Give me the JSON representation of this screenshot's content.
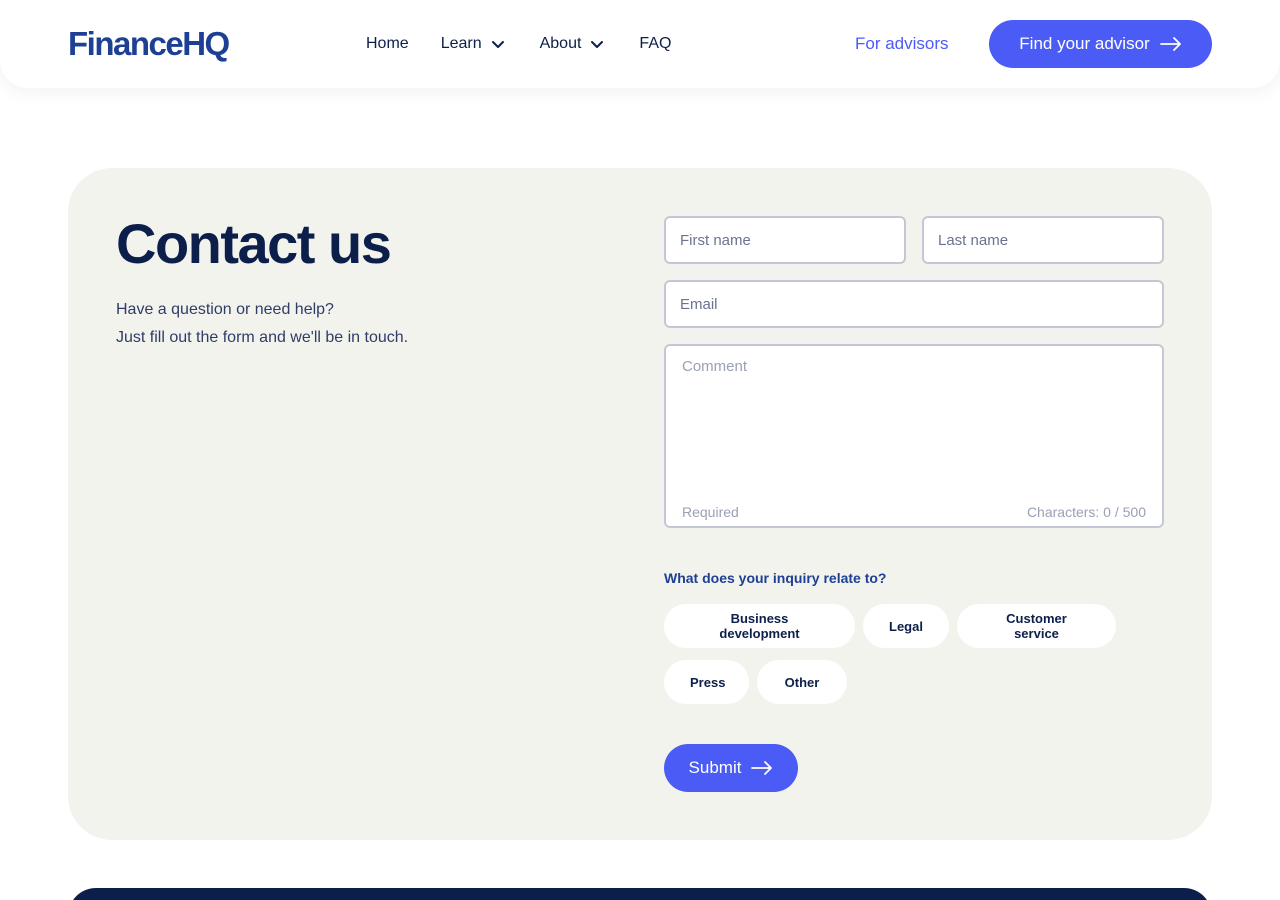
{
  "brand": {
    "logo": "FinanceHQ"
  },
  "nav": {
    "items": [
      {
        "label": "Home"
      },
      {
        "label": "Learn",
        "icon": "chevron-down-icon"
      },
      {
        "label": "About",
        "icon": "chevron-down-icon"
      },
      {
        "label": "FAQ"
      }
    ],
    "for_advisors": "For advisors",
    "cta": {
      "label": "Find your advisor",
      "icon": "arrow-right-icon"
    }
  },
  "contact": {
    "title": "Contact us",
    "subtitle_line1": "Have a question or need help?",
    "subtitle_line2": "Just fill out the form and we'll be in touch."
  },
  "form": {
    "first_name_placeholder": "First name",
    "last_name_placeholder": "Last name",
    "email_placeholder": "Email",
    "comment_placeholder": "Comment",
    "comment_required": "Required",
    "comment_counter": "Characters: 0 / 500",
    "inquiry_label": "What does your inquiry relate to?",
    "inquiry_options": [
      "Business development",
      "Legal",
      "Customer service",
      "Press",
      "Other"
    ],
    "submit_label": "Submit"
  },
  "colors": {
    "accent": "#4a5cf5",
    "brand_navy": "#0c1f4a",
    "logo_blue": "#1d3f94",
    "card_bg": "#f3f3ee"
  }
}
